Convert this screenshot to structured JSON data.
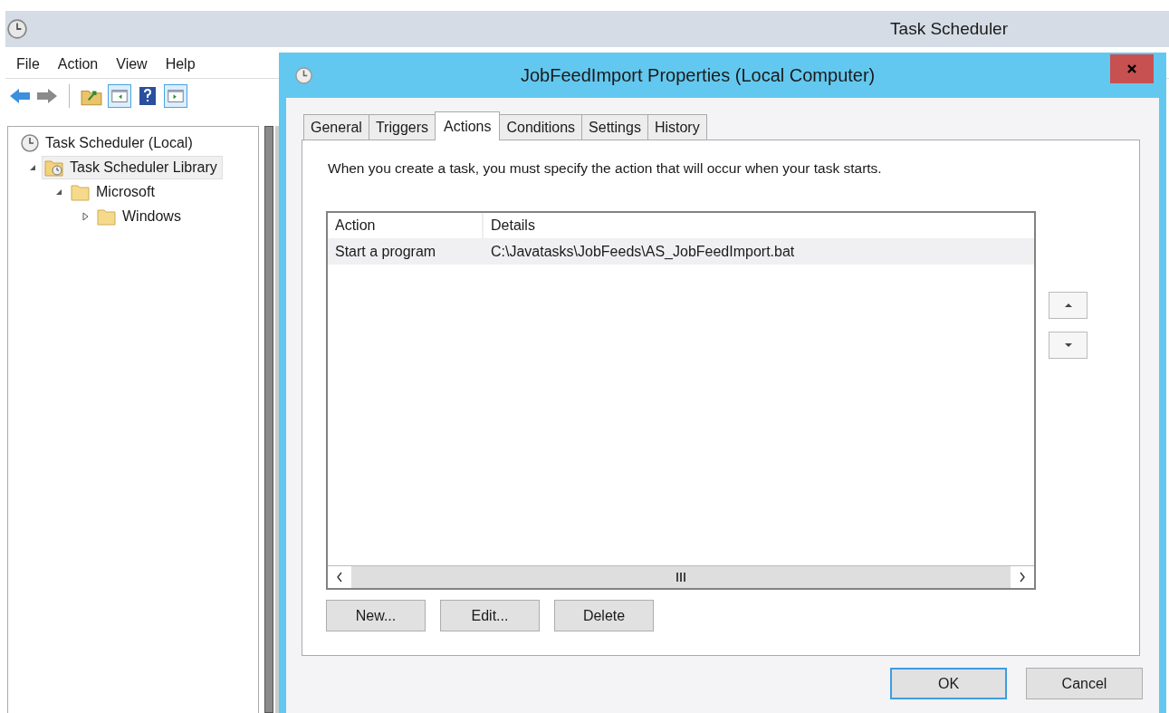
{
  "window": {
    "title": "Task Scheduler"
  },
  "menu": [
    "File",
    "Action",
    "View",
    "Help"
  ],
  "tree": [
    {
      "label": "Task Scheduler (Local)",
      "kind": "clock",
      "selected": false,
      "children": [
        {
          "label": "Task Scheduler Library",
          "kind": "library",
          "selected": true,
          "expanded": true,
          "children": [
            {
              "label": "Microsoft",
              "kind": "folder",
              "selected": false,
              "expanded": true,
              "children": [
                {
                  "label": "Windows",
                  "kind": "folder",
                  "selected": false,
                  "expanded": false
                }
              ]
            }
          ]
        }
      ]
    }
  ],
  "dialog": {
    "title": "JobFeedImport Properties (Local Computer)",
    "tabs": [
      {
        "label": "General",
        "selected": false
      },
      {
        "label": "Triggers",
        "selected": false
      },
      {
        "label": "Actions",
        "selected": true
      },
      {
        "label": "Conditions",
        "selected": false
      },
      {
        "label": "Settings",
        "selected": false
      },
      {
        "label": "History",
        "selected": false
      }
    ],
    "description": "When you create a task, you must specify the action that will occur when your task starts.",
    "table": {
      "columns": [
        "Action",
        "Details"
      ],
      "rows": [
        {
          "cells": [
            "Start a program",
            "C:\\Javatasks\\JobFeeds\\AS_JobFeedImport.bat"
          ],
          "selected": true
        }
      ]
    },
    "action_buttons": [
      "New...",
      "Edit...",
      "Delete"
    ],
    "footer_buttons": [
      {
        "label": "OK",
        "default": true
      },
      {
        "label": "Cancel",
        "default": false
      }
    ]
  }
}
